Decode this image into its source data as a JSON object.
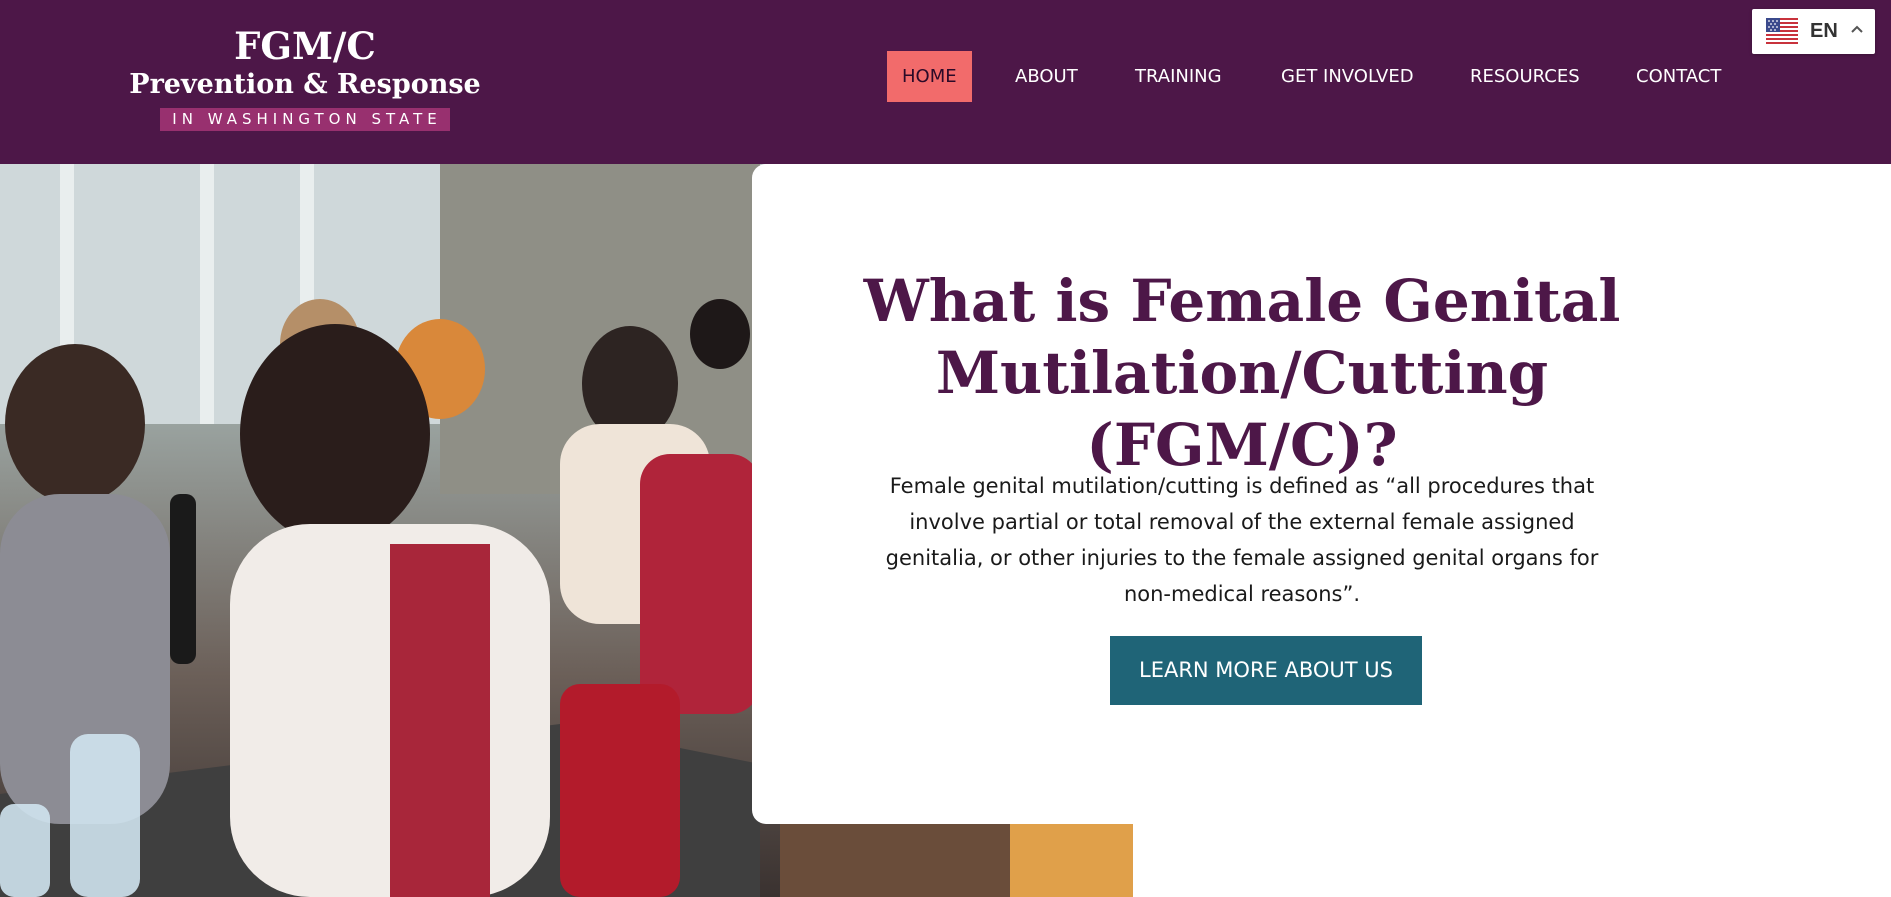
{
  "logo": {
    "line1": "FGM/C",
    "line2": "Prevention & Response",
    "line3": "IN WASHINGTON STATE"
  },
  "nav": {
    "items": [
      {
        "label": "HOME",
        "active": true
      },
      {
        "label": "ABOUT",
        "active": false
      },
      {
        "label": "TRAINING",
        "active": false
      },
      {
        "label": "GET INVOLVED",
        "active": false
      },
      {
        "label": "RESOURCES",
        "active": false
      },
      {
        "label": "CONTACT",
        "active": false
      }
    ]
  },
  "language": {
    "code": "EN",
    "flag_icon": "us-flag-icon",
    "caret_icon": "chevron-up-icon"
  },
  "hero": {
    "photo_icon": "hero-photo",
    "title": "What is Female Genital Mutilation/Cutting (FGM/C)?",
    "body": "Female genital mutilation/cutting is defined as “all procedures that involve partial or total removal of the external female assigned genitalia, or other injuries to the female assigned genital organs for non-medical reasons”.",
    "cta_label": "LEARN MORE ABOUT US"
  },
  "colors": {
    "header_bg": "#4d1748",
    "active_nav_bg": "#f26b6b",
    "logo_tag_bg": "#98306f",
    "title_color": "#4d1748",
    "cta_bg": "#1f6477"
  }
}
